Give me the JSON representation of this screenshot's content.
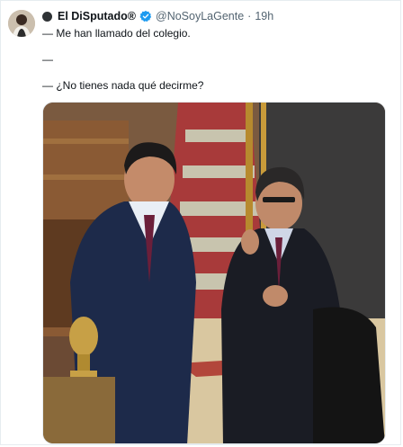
{
  "tweet": {
    "display_name": "El DiSputado®",
    "handle": "@NoSoyLaGente",
    "separator": "·",
    "time": "19h",
    "lines": [
      "— Me han llamado del colegio.",
      "—",
      "— ¿No tienes nada qué decirme?"
    ]
  },
  "colors": {
    "verified": "#1d9bf0",
    "secondary_text": "#536471"
  },
  "icons": {
    "verified": "verified-badge-icon",
    "name_prefix": "dark-circle-icon"
  }
}
